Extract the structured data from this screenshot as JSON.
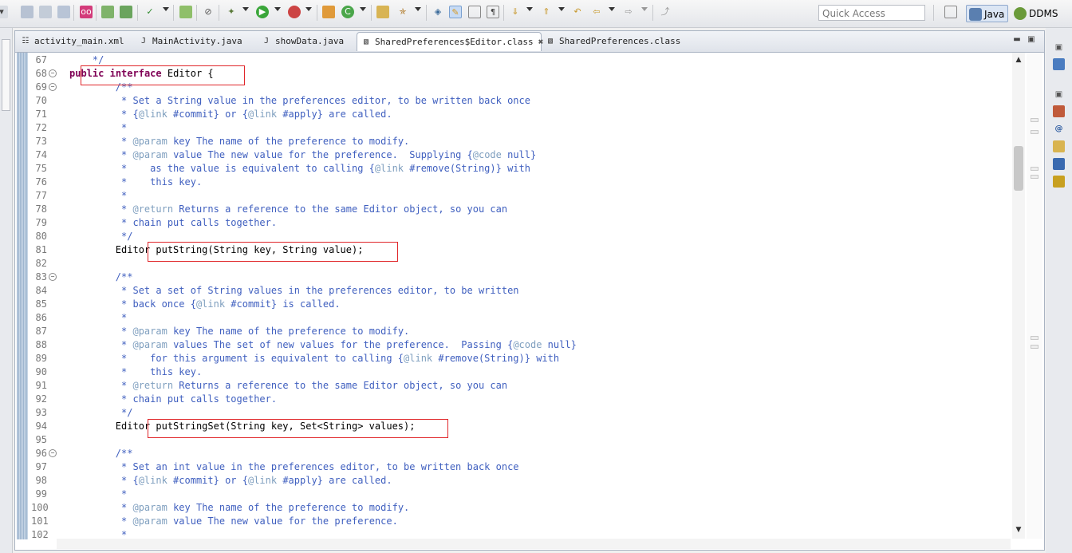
{
  "toolbar": {
    "quick_access_placeholder": "Quick Access",
    "perspectives": [
      {
        "label": "Java"
      },
      {
        "label": "DDMS"
      }
    ]
  },
  "editor": {
    "tabs": [
      {
        "label": "activity_main.xml"
      },
      {
        "label": "MainActivity.java"
      },
      {
        "label": "showData.java"
      },
      {
        "label": "SharedPreferences$Editor.class",
        "close": "✖"
      },
      {
        "label": "SharedPreferences.class"
      }
    ],
    "lines": [
      {
        "no": "67",
        "parts": [
          {
            "t": "    */",
            "c": "c"
          }
        ]
      },
      {
        "no": "68",
        "fold": true,
        "parts": [
          {
            "t": "public",
            "c": "k"
          },
          {
            "t": " ",
            "c": "p"
          },
          {
            "t": "interface",
            "c": "k"
          },
          {
            "t": " Editor {",
            "c": "p"
          }
        ]
      },
      {
        "no": "69",
        "fold": true,
        "parts": [
          {
            "t": "        /**",
            "c": "c"
          }
        ]
      },
      {
        "no": "70",
        "parts": [
          {
            "t": "         * Set a String value in the preferences editor, to be written back once",
            "c": "c"
          }
        ]
      },
      {
        "no": "71",
        "parts": [
          {
            "t": "         * {",
            "c": "c"
          },
          {
            "t": "@link",
            "c": "tg"
          },
          {
            "t": " #commit} or {",
            "c": "c"
          },
          {
            "t": "@link",
            "c": "tg"
          },
          {
            "t": " #apply} are called.",
            "c": "c"
          }
        ]
      },
      {
        "no": "72",
        "parts": [
          {
            "t": "         *",
            "c": "c"
          }
        ]
      },
      {
        "no": "73",
        "parts": [
          {
            "t": "         * ",
            "c": "c"
          },
          {
            "t": "@param",
            "c": "tg"
          },
          {
            "t": " key The name of the preference to modify.",
            "c": "c"
          }
        ]
      },
      {
        "no": "74",
        "parts": [
          {
            "t": "         * ",
            "c": "c"
          },
          {
            "t": "@param",
            "c": "tg"
          },
          {
            "t": " value The new value for the preference.  Supplying {",
            "c": "c"
          },
          {
            "t": "@code",
            "c": "tg"
          },
          {
            "t": " null}",
            "c": "c"
          }
        ]
      },
      {
        "no": "75",
        "parts": [
          {
            "t": "         *    as the value is equivalent to calling {",
            "c": "c"
          },
          {
            "t": "@link",
            "c": "tg"
          },
          {
            "t": " #remove(String)} with",
            "c": "c"
          }
        ]
      },
      {
        "no": "76",
        "parts": [
          {
            "t": "         *    this key.",
            "c": "c"
          }
        ]
      },
      {
        "no": "77",
        "parts": [
          {
            "t": "         *",
            "c": "c"
          }
        ]
      },
      {
        "no": "78",
        "parts": [
          {
            "t": "         * ",
            "c": "c"
          },
          {
            "t": "@return",
            "c": "tg"
          },
          {
            "t": " Returns a reference to the same Editor object, so you can",
            "c": "c"
          }
        ]
      },
      {
        "no": "79",
        "parts": [
          {
            "t": "         * chain put calls together.",
            "c": "c"
          }
        ]
      },
      {
        "no": "80",
        "parts": [
          {
            "t": "         */",
            "c": "c"
          }
        ]
      },
      {
        "no": "81",
        "parts": [
          {
            "t": "        Editor putString(String key, String value);",
            "c": "p"
          }
        ]
      },
      {
        "no": "82",
        "parts": [
          {
            "t": "",
            "c": "p"
          }
        ]
      },
      {
        "no": "83",
        "fold": true,
        "parts": [
          {
            "t": "        /**",
            "c": "c"
          }
        ]
      },
      {
        "no": "84",
        "parts": [
          {
            "t": "         * Set a set of String values in the preferences editor, to be written",
            "c": "c"
          }
        ]
      },
      {
        "no": "85",
        "parts": [
          {
            "t": "         * back once {",
            "c": "c"
          },
          {
            "t": "@link",
            "c": "tg"
          },
          {
            "t": " #commit} is called.",
            "c": "c"
          }
        ]
      },
      {
        "no": "86",
        "parts": [
          {
            "t": "         *",
            "c": "c"
          }
        ]
      },
      {
        "no": "87",
        "parts": [
          {
            "t": "         * ",
            "c": "c"
          },
          {
            "t": "@param",
            "c": "tg"
          },
          {
            "t": " key The name of the preference to modify.",
            "c": "c"
          }
        ]
      },
      {
        "no": "88",
        "parts": [
          {
            "t": "         * ",
            "c": "c"
          },
          {
            "t": "@param",
            "c": "tg"
          },
          {
            "t": " values The set of new values for the preference.  Passing {",
            "c": "c"
          },
          {
            "t": "@code",
            "c": "tg"
          },
          {
            "t": " null}",
            "c": "c"
          }
        ]
      },
      {
        "no": "89",
        "parts": [
          {
            "t": "         *    for this argument is equivalent to calling {",
            "c": "c"
          },
          {
            "t": "@link",
            "c": "tg"
          },
          {
            "t": " #remove(String)} with",
            "c": "c"
          }
        ]
      },
      {
        "no": "90",
        "parts": [
          {
            "t": "         *    this key.",
            "c": "c"
          }
        ]
      },
      {
        "no": "91",
        "parts": [
          {
            "t": "         * ",
            "c": "c"
          },
          {
            "t": "@return",
            "c": "tg"
          },
          {
            "t": " Returns a reference to the same Editor object, so you can",
            "c": "c"
          }
        ]
      },
      {
        "no": "92",
        "parts": [
          {
            "t": "         * chain put calls together.",
            "c": "c"
          }
        ]
      },
      {
        "no": "93",
        "parts": [
          {
            "t": "         */",
            "c": "c"
          }
        ]
      },
      {
        "no": "94",
        "parts": [
          {
            "t": "        Editor putStringSet(String key, Set<String> values);",
            "c": "p"
          }
        ]
      },
      {
        "no": "95",
        "parts": [
          {
            "t": "",
            "c": "p"
          }
        ]
      },
      {
        "no": "96",
        "fold": true,
        "parts": [
          {
            "t": "        /**",
            "c": "c"
          }
        ]
      },
      {
        "no": "97",
        "parts": [
          {
            "t": "         * Set an int value in the preferences editor, to be written back once",
            "c": "c"
          }
        ]
      },
      {
        "no": "98",
        "parts": [
          {
            "t": "         * {",
            "c": "c"
          },
          {
            "t": "@link",
            "c": "tg"
          },
          {
            "t": " #commit} or {",
            "c": "c"
          },
          {
            "t": "@link",
            "c": "tg"
          },
          {
            "t": " #apply} are called.",
            "c": "c"
          }
        ]
      },
      {
        "no": "99",
        "parts": [
          {
            "t": "         *",
            "c": "c"
          }
        ]
      },
      {
        "no": "100",
        "parts": [
          {
            "t": "         * ",
            "c": "c"
          },
          {
            "t": "@param",
            "c": "tg"
          },
          {
            "t": " key The name of the preference to modify.",
            "c": "c"
          }
        ]
      },
      {
        "no": "101",
        "parts": [
          {
            "t": "         * ",
            "c": "c"
          },
          {
            "t": "@param",
            "c": "tg"
          },
          {
            "t": " value The new value for the preference.",
            "c": "c"
          }
        ]
      },
      {
        "no": "102",
        "parts": [
          {
            "t": "         *",
            "c": "c"
          }
        ]
      }
    ]
  }
}
